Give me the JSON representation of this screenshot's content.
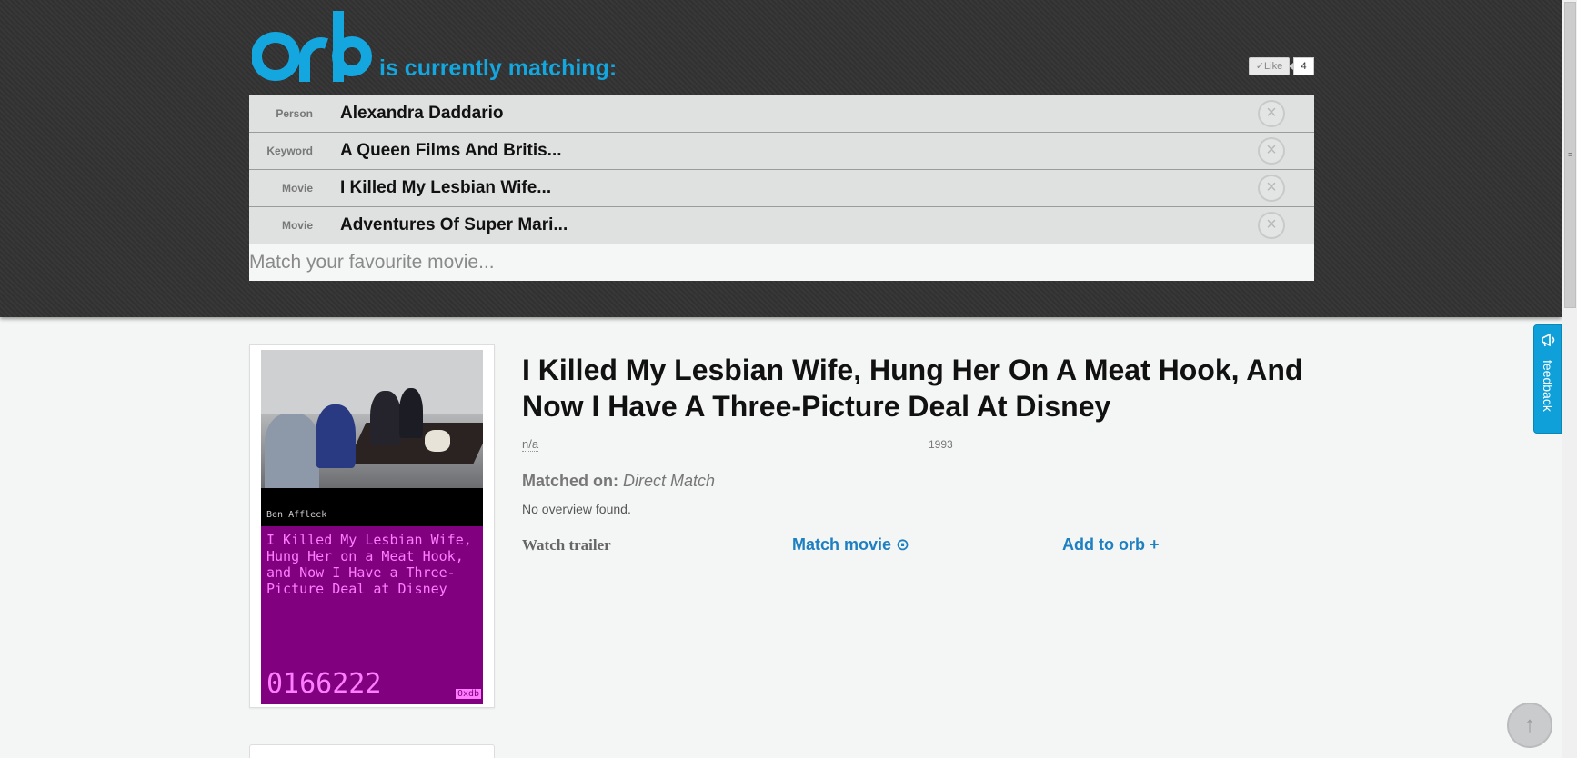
{
  "header": {
    "logo_text": "orb",
    "tagline": "is currently matching:",
    "like_label": "✓Like",
    "like_count": "4"
  },
  "matches": [
    {
      "type": "Person",
      "value": "Alexandra Daddario"
    },
    {
      "type": "Keyword",
      "value": "A Queen Films And Britis..."
    },
    {
      "type": "Movie",
      "value": "I Killed My Lesbian Wife..."
    },
    {
      "type": "Movie",
      "value": "Adventures Of Super Mari..."
    }
  ],
  "search": {
    "placeholder": "Match your favourite movie..."
  },
  "poster": {
    "actor": "Ben Affleck",
    "title": "I Killed My Lesbian Wife, Hung Her on a Meat Hook, and Now I Have a Three-Picture Deal at Disney",
    "id": "0166222",
    "brand": "0xdb"
  },
  "movie": {
    "title": "I Killed My Lesbian Wife, Hung Her On A Meat Hook, And Now I Have A Three-Picture Deal At Disney",
    "rating": "n/a",
    "year": "1993",
    "matched_on_label": "Matched on:",
    "matched_on_value": "Direct Match",
    "overview": "No overview found."
  },
  "actions": {
    "watch_trailer": "Watch trailer ⃞",
    "match_movie": "Match movie ⊙",
    "add_to_orb": "Add to orb +"
  },
  "feedback": {
    "label": "feedback"
  },
  "colors": {
    "brand": "#13a6df",
    "link": "#1e7fc1",
    "poster": "#800080"
  }
}
